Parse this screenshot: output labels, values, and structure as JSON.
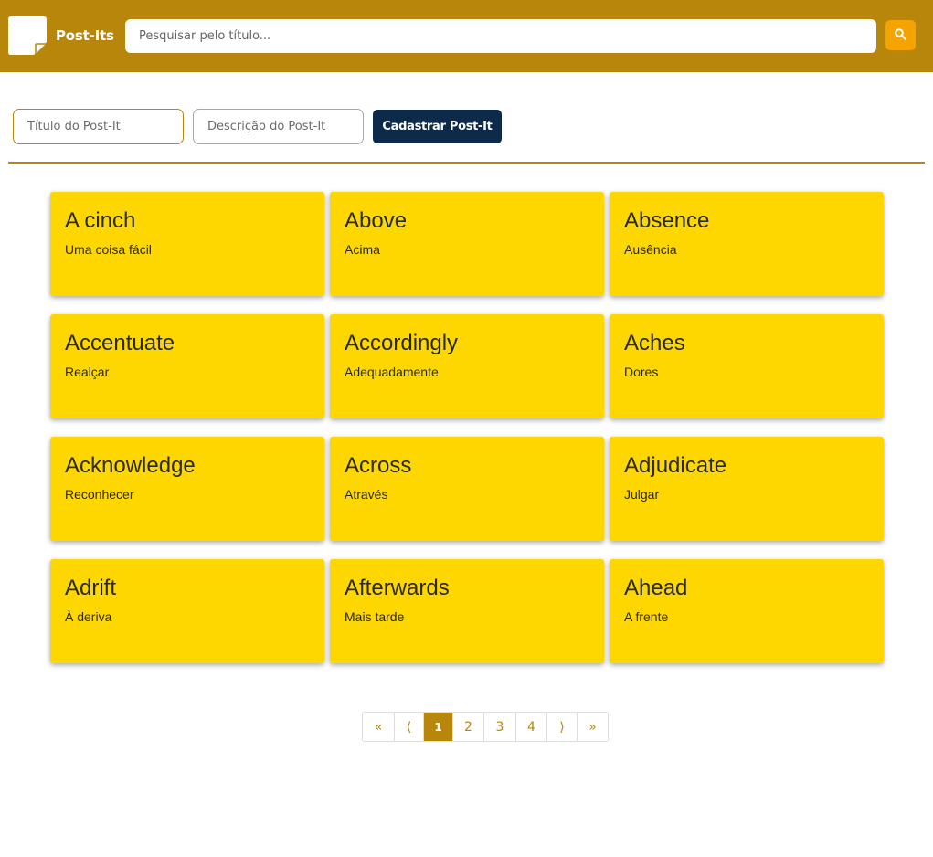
{
  "header": {
    "brand": "Post-Its",
    "search_placeholder": "Pesquisar pelo título...",
    "search_icon": "search-icon",
    "logo_icon": "post-it-icon"
  },
  "form": {
    "title_placeholder": "Título do Post-It",
    "description_placeholder": "Descrição do Post-It",
    "submit_label": "Cadastrar Post-It"
  },
  "postits": [
    {
      "title": "A cinch",
      "description": "Uma coisa fácil"
    },
    {
      "title": "Above",
      "description": "Acima"
    },
    {
      "title": "Absence",
      "description": "Ausência"
    },
    {
      "title": "Accentuate",
      "description": "Realçar"
    },
    {
      "title": "Accordingly",
      "description": "Adequadamente"
    },
    {
      "title": "Aches",
      "description": "Dores"
    },
    {
      "title": "Acknowledge",
      "description": "Reconhecer"
    },
    {
      "title": "Across",
      "description": "Através"
    },
    {
      "title": "Adjudicate",
      "description": "Julgar"
    },
    {
      "title": "Adrift",
      "description": "À deriva"
    },
    {
      "title": "Afterwards",
      "description": "Mais tarde"
    },
    {
      "title": "Ahead",
      "description": "A frente"
    }
  ],
  "pagination": {
    "first": "«",
    "prev": "⟨",
    "pages": [
      "1",
      "2",
      "3",
      "4"
    ],
    "current": "1",
    "next": "⟩",
    "last": "»"
  },
  "colors": {
    "header": "#b8860b",
    "card": "#ffd700",
    "search_button": "#f5a300",
    "submit_button": "#0d2a4a"
  }
}
